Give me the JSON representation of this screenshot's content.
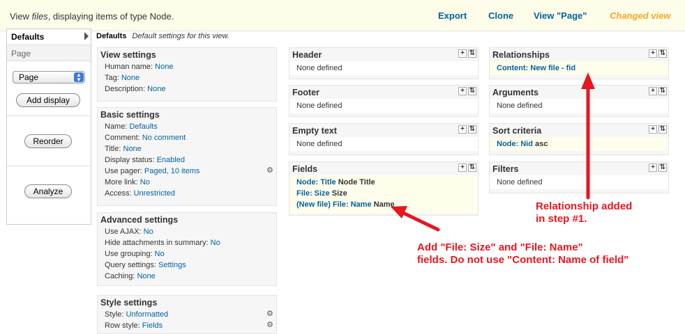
{
  "header": {
    "title_prefix": "View ",
    "title_view": "files",
    "title_suffix": ", displaying items of type Node.",
    "export": "Export",
    "clone": "Clone",
    "view_page": "View \"Page\"",
    "changed": "Changed view"
  },
  "tabs": {
    "defaults": "Defaults",
    "page": "Page",
    "select_value": "Page",
    "add_display": "Add display",
    "reorder": "Reorder",
    "analyze": "Analyze"
  },
  "crumb": {
    "title": "Defaults",
    "desc": "Default settings for this view."
  },
  "view_settings": {
    "title": "View settings",
    "rows": [
      {
        "label": "Human name: ",
        "value": "None"
      },
      {
        "label": "Tag: ",
        "value": "None"
      },
      {
        "label": "Description: ",
        "value": "None"
      }
    ]
  },
  "basic_settings": {
    "title": "Basic settings",
    "rows": [
      {
        "label": "Name: ",
        "value": "Defaults"
      },
      {
        "label": "Comment: ",
        "value": "No comment"
      },
      {
        "label": "Title: ",
        "value": "None"
      },
      {
        "label": "Display status: ",
        "value": "Enabled"
      },
      {
        "label": "Use pager: ",
        "value": "Paged, 10 items"
      },
      {
        "label": "More link: ",
        "value": "No"
      },
      {
        "label": "Access: ",
        "value": "Unrestricted"
      }
    ]
  },
  "advanced_settings": {
    "title": "Advanced settings",
    "rows": [
      {
        "label": "Use AJAX: ",
        "value": "No"
      },
      {
        "label": "Hide attachments in summary: ",
        "value": "No"
      },
      {
        "label": "Use grouping: ",
        "value": "No"
      },
      {
        "label": "Query settings: ",
        "value": "Settings"
      },
      {
        "label": "Caching: ",
        "value": "None"
      }
    ]
  },
  "style_settings": {
    "title": "Style settings",
    "rows": [
      {
        "label": "Style: ",
        "value": "Unformatted"
      },
      {
        "label": "Row style: ",
        "value": "Fields"
      }
    ]
  },
  "mid": {
    "header_title": "Header",
    "header_content": "None defined",
    "footer_title": "Footer",
    "footer_content": "None defined",
    "empty_title": "Empty text",
    "empty_content": "None defined",
    "fields_title": "Fields",
    "fields": [
      {
        "link": "Node: Title",
        "text": " Node Title"
      },
      {
        "link": "File: Size",
        "text": " Size"
      },
      {
        "link": "(New file) File: Name",
        "text": " Name"
      }
    ]
  },
  "right": {
    "relationships_title": "Relationships",
    "relationship": "Content: New file - fid",
    "arguments_title": "Arguments",
    "arguments_content": "None defined",
    "sort_title": "Sort criteria",
    "sort_link": "Node: Nid",
    "sort_text": " asc",
    "filters_title": "Filters",
    "filters_content": "None defined"
  },
  "annotations": {
    "relationship_line1": "Relationship added",
    "relationship_line2": "in step #1.",
    "fields_line1": "Add \"File: Size\" and \"File: Name\"",
    "fields_line2": "fields. Do not use \"Content: Name of field\""
  },
  "colors": {
    "link": "#0062a0",
    "changed": "#f5a623",
    "annotation": "#e8161f",
    "topbar": "#fefde9"
  }
}
